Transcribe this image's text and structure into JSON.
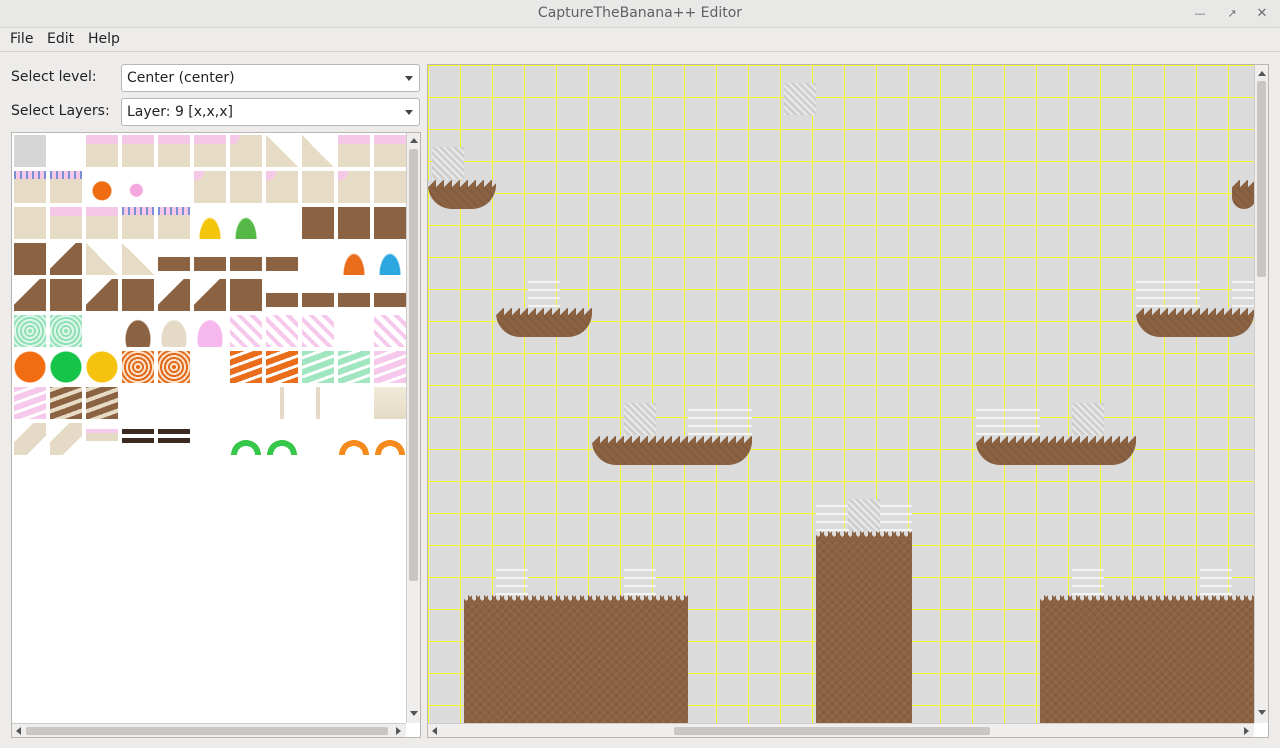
{
  "window": {
    "title": "CaptureTheBanana++ Editor",
    "minimize_icon": "minimize-icon",
    "maximize_icon": "maximize-icon",
    "close_icon": "close-icon"
  },
  "menu": {
    "file": "File",
    "edit": "Edit",
    "help": "Help"
  },
  "controls": {
    "level_label": "Select level:",
    "level_value": "Center (center)",
    "layers_label": "Select Layers:",
    "layers_value": "Layer: 9 [x,x,x]"
  },
  "colors": {
    "grid_line": "#ffff00",
    "empty_cell": "#dbdbdb",
    "dirt": "#8b6242",
    "frosting": "#f6c8e8",
    "wafer": "#e6dcc6"
  }
}
